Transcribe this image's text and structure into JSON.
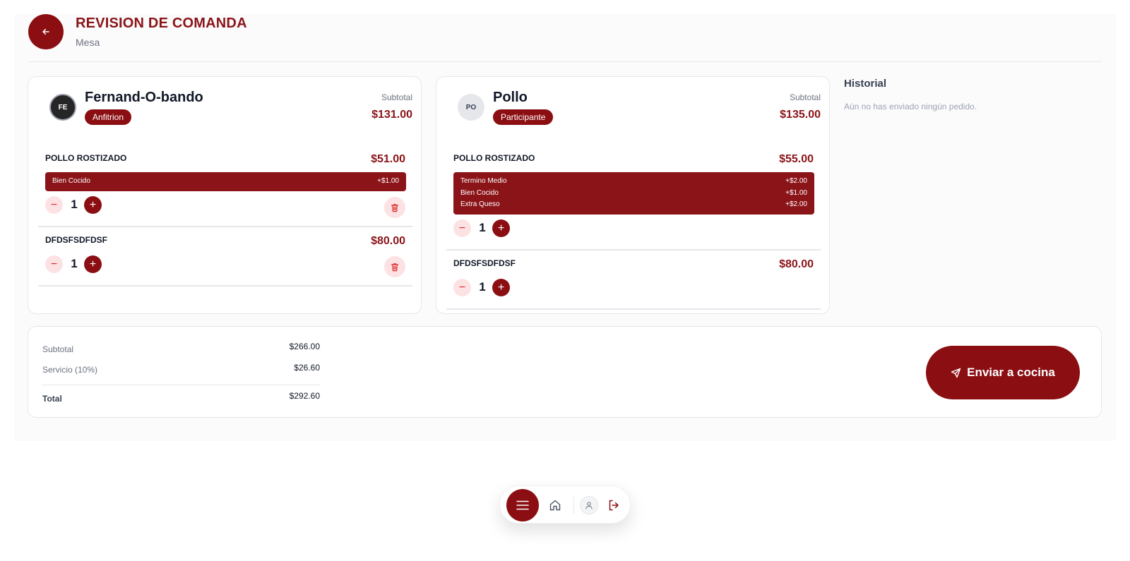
{
  "header": {
    "title": "REVISION DE COMANDA",
    "subtitle": "Mesa",
    "back_icon": "arrow-left-icon"
  },
  "guests": [
    {
      "initials": "FE",
      "name": "Fernand-O-bando",
      "role": "Anfitrion",
      "subtotal_label": "Subtotal",
      "subtotal": "$131.00",
      "items": [
        {
          "name": "POLLO ROSTIZADO",
          "price": "$51.00",
          "quantity": "1",
          "modifiers": [
            {
              "name": "Bien Cocido",
              "price": "+$1.00"
            }
          ]
        },
        {
          "name": "DFDSFSDFDSF",
          "price": "$80.00",
          "quantity": "1",
          "modifiers": []
        }
      ]
    },
    {
      "initials": "PO",
      "name": "Pollo",
      "role": "Participante",
      "subtotal_label": "Subtotal",
      "subtotal": "$135.00",
      "items": [
        {
          "name": "POLLO ROSTIZADO",
          "price": "$55.00",
          "quantity": "1",
          "modifiers": [
            {
              "name": "Termino Medio",
              "price": "+$2.00"
            },
            {
              "name": "Bien Cocido",
              "price": "+$1.00"
            },
            {
              "name": "Extra Queso",
              "price": "+$2.00"
            }
          ]
        },
        {
          "name": "DFDSFSDFDSF",
          "price": "$80.00",
          "quantity": "1",
          "modifiers": []
        }
      ]
    }
  ],
  "history": {
    "title": "Historial",
    "empty_message": "Aún no has enviado ningún pedido."
  },
  "summary": {
    "subtotal_label": "Subtotal",
    "subtotal_value": "$266.00",
    "service_label": "Servicio (10%)",
    "service_value": "$26.60",
    "total_label": "Total",
    "total_value": "$292.60",
    "send_label": "Enviar a cocina",
    "send_icon": "send-icon"
  },
  "nav": {
    "menu_icon": "menu-icon",
    "home_icon": "home-icon",
    "user_icon": "user-icon",
    "logout_icon": "logout-icon"
  },
  "colors": {
    "primary": "#8b0e12",
    "accent_text": "#8b1418",
    "soft_pink": "#fde2e4"
  }
}
